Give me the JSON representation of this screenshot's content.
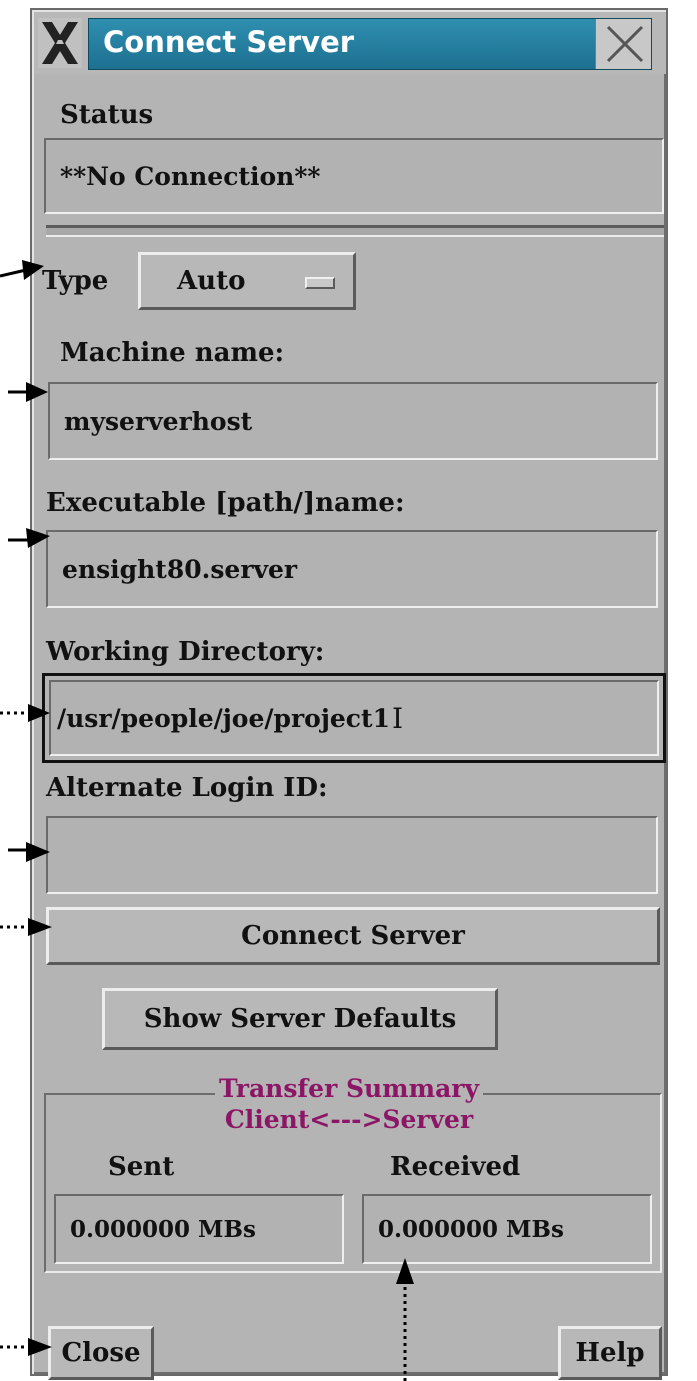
{
  "window": {
    "title": "Connect Server",
    "close_icon": "close-x-icon",
    "logo_icon": "x-window-logo-icon"
  },
  "status": {
    "label": "Status",
    "value": "**No Connection**"
  },
  "type": {
    "label": "Type",
    "selected": "Auto"
  },
  "machine": {
    "label": "Machine name:",
    "value": "myserverhost"
  },
  "executable": {
    "label": "Executable [path/]name:",
    "value": "ensight80.server"
  },
  "workdir": {
    "label": "Working Directory:",
    "value": "/usr/people/joe/project1",
    "cursor": "I"
  },
  "login": {
    "label": "Alternate Login ID:",
    "value": ""
  },
  "buttons": {
    "connect": "Connect Server",
    "show_defaults": "Show Server Defaults",
    "close": "Close",
    "help": "Help"
  },
  "transfer": {
    "title_line1": "Transfer Summary",
    "title_line2": "Client<--->Server",
    "sent_label": "Sent",
    "received_label": "Received",
    "sent_value": "0.000000 MBs",
    "received_value": "0.000000 MBs"
  },
  "colors": {
    "title_bar": "#1d7090",
    "panel_bg": "#b4b4b4",
    "transfer_title": "#8c1666"
  }
}
